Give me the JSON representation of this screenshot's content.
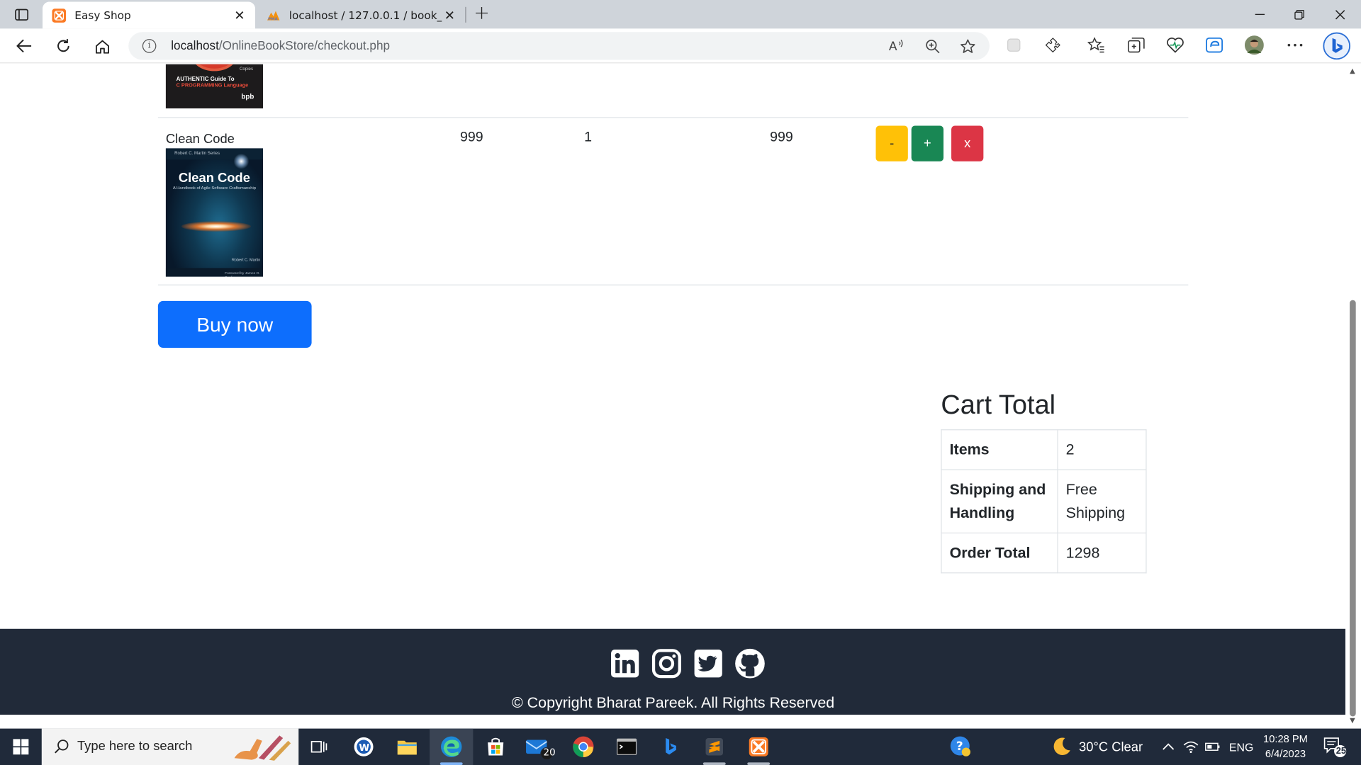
{
  "browser": {
    "tabs": [
      {
        "title": "Easy Shop",
        "active": true
      },
      {
        "title": "localhost / 127.0.0.1 / book_store",
        "active": false
      }
    ],
    "url_host": "localhost",
    "url_path": "/OnlineBookStore/checkout.php"
  },
  "cart": {
    "previous_item_cover": {
      "line1": "AUTHENTIC Guide To",
      "line2": "C PROGRAMMING Language",
      "publisher": "bpb",
      "badge": "Copies"
    },
    "item": {
      "name": "Clean Code",
      "price": "999",
      "quantity": "1",
      "subtotal": "999",
      "cover": {
        "series": "Robert C. Martin Series",
        "title": "Clean Code",
        "subtitle": "A Handbook of Agile Software Craftsmanship",
        "author": "Robert C. Martin",
        "foreword": "Foreword by James O. Coplien"
      },
      "buttons": {
        "minus": "-",
        "plus": "+",
        "remove": "x"
      }
    },
    "buy_label": "Buy now"
  },
  "cart_total": {
    "title": "Cart Total",
    "rows": [
      {
        "label": "Items",
        "value": "2"
      },
      {
        "label": "Shipping and Handling",
        "value": "Free Shipping"
      },
      {
        "label": "Order Total",
        "value": "1298"
      }
    ]
  },
  "footer": {
    "social": [
      "linkedin-icon",
      "instagram-icon",
      "twitter-icon",
      "github-icon"
    ],
    "copyright": "© Copyright Bharat Pareek. All Rights Reserved"
  },
  "taskbar": {
    "search_placeholder": "Type here to search",
    "mail_badge": "20",
    "weather": "30°C  Clear",
    "language": "ENG",
    "time": "10:28 PM",
    "date": "6/4/2023",
    "notification_count": "25"
  },
  "colors": {
    "primary": "#0d6efd",
    "warning": "#ffc107",
    "success": "#198754",
    "danger": "#dc3545",
    "footer_bg": "#212a39",
    "taskbar_bg": "#202a3a"
  }
}
